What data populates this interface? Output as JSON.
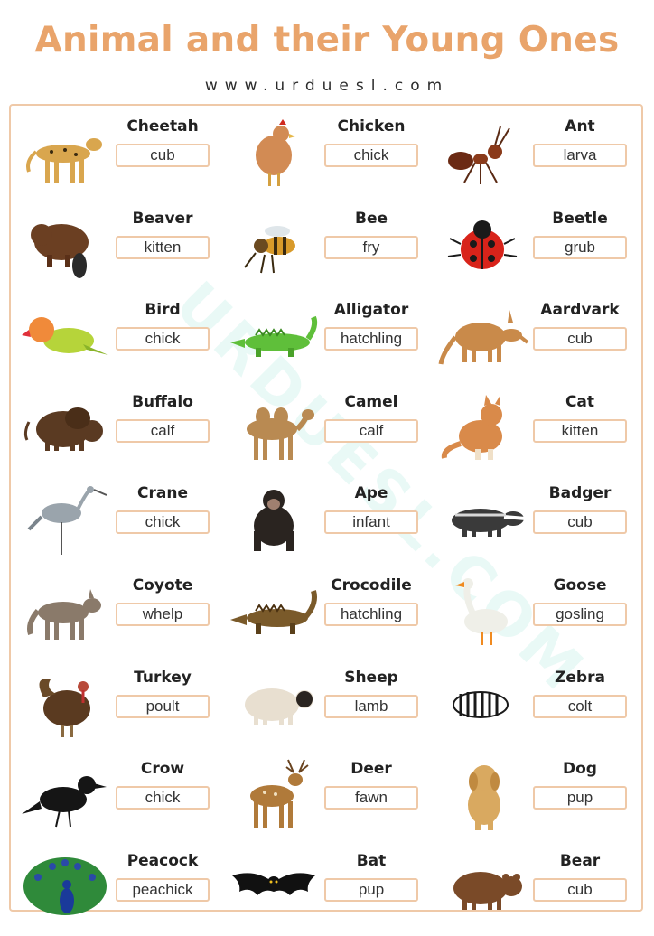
{
  "title": "Animal and their Young Ones",
  "website": "www.urduesl.com",
  "watermark": "URDUESL.COM",
  "colors": {
    "title": "#e9a46b",
    "border": "#efc9a8"
  },
  "animals": [
    {
      "name": "Cheetah",
      "young": "cub",
      "icon": "cheetah-icon"
    },
    {
      "name": "Chicken",
      "young": "chick",
      "icon": "chicken-icon"
    },
    {
      "name": "Ant",
      "young": "larva",
      "icon": "ant-icon"
    },
    {
      "name": "Beaver",
      "young": "kitten",
      "icon": "beaver-icon"
    },
    {
      "name": "Bee",
      "young": "fry",
      "icon": "bee-icon"
    },
    {
      "name": "Beetle",
      "young": "grub",
      "icon": "beetle-icon"
    },
    {
      "name": "Bird",
      "young": "chick",
      "icon": "bird-icon"
    },
    {
      "name": "Alligator",
      "young": "hatchling",
      "icon": "alligator-icon"
    },
    {
      "name": "Aardvark",
      "young": "cub",
      "icon": "aardvark-icon"
    },
    {
      "name": "Buffalo",
      "young": "calf",
      "icon": "buffalo-icon"
    },
    {
      "name": "Camel",
      "young": "calf",
      "icon": "camel-icon"
    },
    {
      "name": "Cat",
      "young": "kitten",
      "icon": "cat-icon"
    },
    {
      "name": "Crane",
      "young": "chick",
      "icon": "crane-icon"
    },
    {
      "name": "Ape",
      "young": "infant",
      "icon": "ape-icon"
    },
    {
      "name": "Badger",
      "young": "cub",
      "icon": "badger-icon"
    },
    {
      "name": "Coyote",
      "young": "whelp",
      "icon": "coyote-icon"
    },
    {
      "name": "Crocodile",
      "young": "hatchling",
      "icon": "crocodile-icon"
    },
    {
      "name": "Goose",
      "young": "gosling",
      "icon": "goose-icon"
    },
    {
      "name": "Turkey",
      "young": "poult",
      "icon": "turkey-icon"
    },
    {
      "name": "Sheep",
      "young": "lamb",
      "icon": "sheep-icon"
    },
    {
      "name": "Zebra",
      "young": "colt",
      "icon": "zebra-icon"
    },
    {
      "name": "Crow",
      "young": "chick",
      "icon": "crow-icon"
    },
    {
      "name": "Deer",
      "young": "fawn",
      "icon": "deer-icon"
    },
    {
      "name": "Dog",
      "young": "pup",
      "icon": "dog-icon"
    },
    {
      "name": "Peacock",
      "young": "peachick",
      "icon": "peacock-icon"
    },
    {
      "name": "Bat",
      "young": "pup",
      "icon": "bat-icon"
    },
    {
      "name": "Bear",
      "young": "cub",
      "icon": "bear-icon"
    }
  ]
}
